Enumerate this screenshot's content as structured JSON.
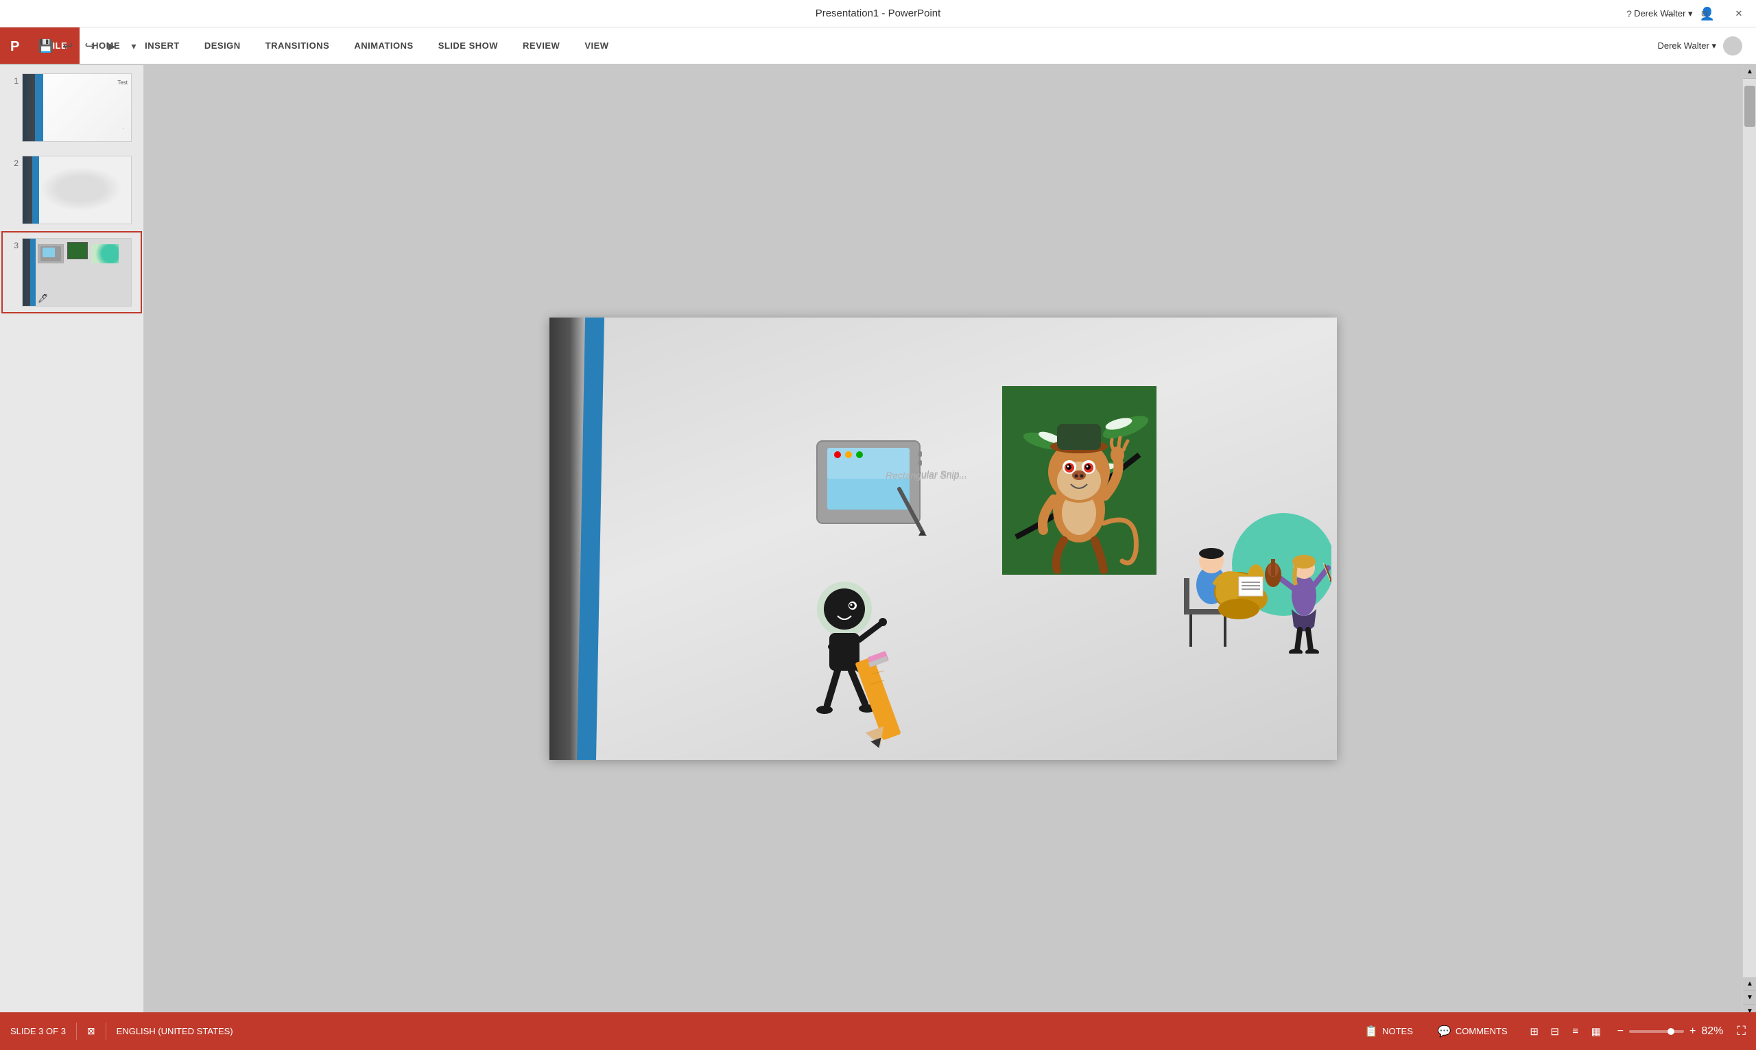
{
  "titleBar": {
    "title": "Presentation1 - PowerPoint",
    "windowControls": [
      "?",
      "—",
      "❐",
      "✕"
    ],
    "userArea": "Derek Walter ▾"
  },
  "ribbon": {
    "tabs": [
      {
        "id": "file",
        "label": "FILE",
        "active": true
      },
      {
        "id": "home",
        "label": "HOME",
        "active": false
      },
      {
        "id": "insert",
        "label": "INSERT",
        "active": false
      },
      {
        "id": "design",
        "label": "DESIGN",
        "active": false
      },
      {
        "id": "transitions",
        "label": "TRANSITIONS",
        "active": false
      },
      {
        "id": "animations",
        "label": "ANIMATIONS",
        "active": false
      },
      {
        "id": "slideshow",
        "label": "SLIDE SHOW",
        "active": false
      },
      {
        "id": "review",
        "label": "REVIEW",
        "active": false
      },
      {
        "id": "view",
        "label": "VIEW",
        "active": false
      }
    ]
  },
  "slides": [
    {
      "number": "1",
      "active": false
    },
    {
      "number": "2",
      "active": false
    },
    {
      "number": "3",
      "active": true
    }
  ],
  "slideCanvas": {
    "snipLabel": "Rectangular Snip..."
  },
  "statusBar": {
    "slideInfo": "SLIDE 3 OF 3",
    "language": "ENGLISH (UNITED STATES)",
    "notes": "NOTES",
    "comments": "COMMENTS",
    "zoomLevel": "82%",
    "fitButton": "⛶"
  }
}
